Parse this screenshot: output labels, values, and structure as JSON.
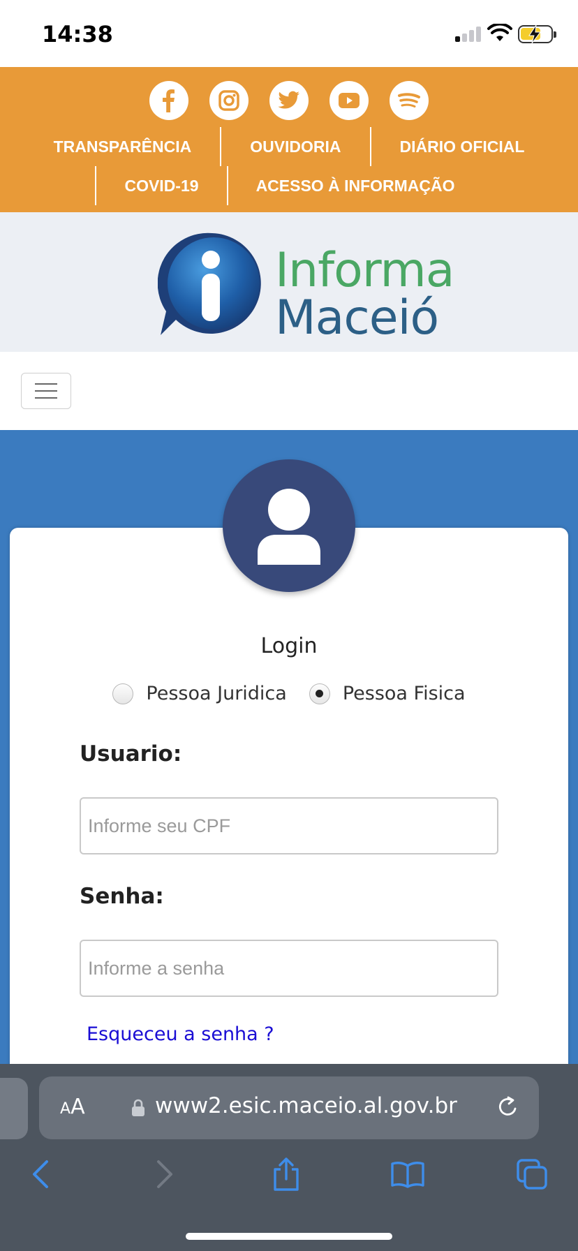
{
  "status_bar": {
    "time": "14:38"
  },
  "header": {
    "socials": [
      "facebook-icon",
      "instagram-icon",
      "twitter-icon",
      "youtube-icon",
      "spotify-icon"
    ],
    "nav_row1": [
      "TRANSPARÊNCIA",
      "OUVIDORIA",
      "DIÁRIO OFICIAL"
    ],
    "nav_row2": [
      "COVID-19",
      "ACESSO À INFORMAÇÃO"
    ]
  },
  "logo": {
    "line1": "Informa",
    "line2": "Maceió"
  },
  "login": {
    "title": "Login",
    "radio_options": [
      {
        "label": "Pessoa Juridica",
        "checked": false
      },
      {
        "label": "Pessoa Fisica",
        "checked": true
      }
    ],
    "user_label": "Usuario:",
    "user_placeholder": "Informe seu CPF",
    "pass_label": "Senha:",
    "pass_placeholder": "Informe a senha",
    "forgot_link": "Esqueceu a senha ?"
  },
  "browser": {
    "aa_small": "A",
    "aa_big": "A",
    "url": "www2.esic.maceio.al.gov.br"
  },
  "colors": {
    "header_orange": "#e89a38",
    "logo_green": "#4aa764",
    "logo_blue": "#2c5f86",
    "page_blue": "#3b7bbf",
    "avatar_navy": "#38497a",
    "link_blue": "#1a0dd4"
  }
}
